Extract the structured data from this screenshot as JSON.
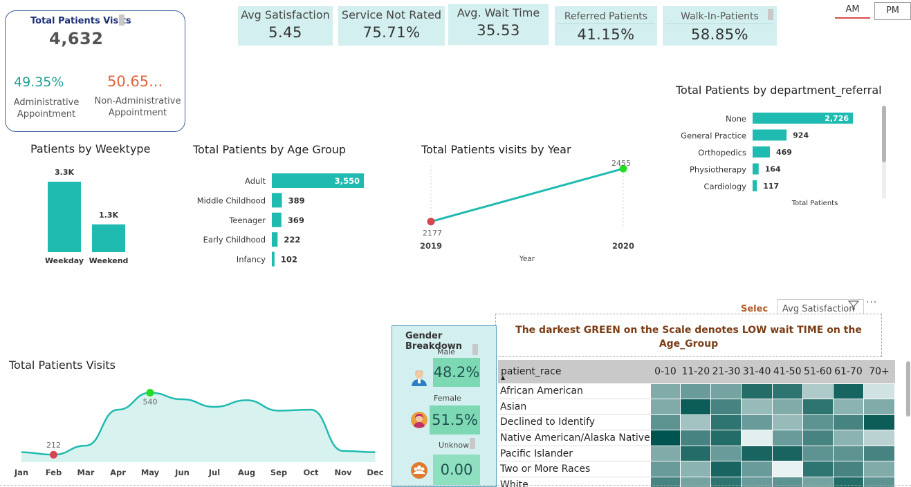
{
  "total_card": {
    "title": "Total Patients Visits",
    "value": "4,632",
    "admin_pct": "49.35%",
    "admin_label_1": "Administrative",
    "admin_label_2": "Appointment",
    "nonadmin_pct": "50.65...",
    "nonadmin_label_1": "Non-Administrative",
    "nonadmin_label_2": "Appointment"
  },
  "kpis": [
    {
      "title": "Avg Satisfaction",
      "value": "5.45"
    },
    {
      "title": "Service Not Rated",
      "value": "75.71%"
    },
    {
      "title": "Avg. Wait Time",
      "value": "35.53"
    },
    {
      "title": "Referred Patients",
      "value": "41.15%"
    },
    {
      "title": "Walk-In-Patients",
      "value": "58.85%"
    }
  ],
  "slicer": {
    "am": "AM",
    "pm": "PM",
    "selected": "AM"
  },
  "colors": {
    "teal": "#1fbab0",
    "teal_light": "#d4efef",
    "red_point": "#d64550",
    "green_point": "#22dd22",
    "note_text": "#7a3d16"
  },
  "weektype": {
    "title": "Patients by Weektype",
    "labels": [
      "3.3K",
      "1.3K"
    ],
    "chart_data": {
      "type": "bar",
      "categories": [
        "Weekday",
        "Weekend"
      ],
      "values": [
        3300,
        1300
      ]
    }
  },
  "age_group": {
    "title": "Total Patients by Age Group",
    "chart_data": {
      "type": "bar",
      "orientation": "horizontal",
      "categories": [
        "Adult",
        "Middle Childhood",
        "Teenager",
        "Early Childhood",
        "Infancy"
      ],
      "values": [
        3550,
        389,
        369,
        222,
        102
      ],
      "labels": [
        "3,550",
        "389",
        "369",
        "222",
        "102"
      ]
    }
  },
  "by_year": {
    "title": "Total Patients visits by Year",
    "xlabel": "Year",
    "chart_data": {
      "type": "line",
      "x": [
        "2019",
        "2020"
      ],
      "values": [
        2177,
        2455
      ],
      "labels": [
        "2177",
        "2455"
      ]
    }
  },
  "department": {
    "title": "Total Patients by department_referral",
    "xlabel": "Total Patients",
    "chart_data": {
      "type": "bar",
      "orientation": "horizontal",
      "categories": [
        "None",
        "General Practice",
        "Orthopedics",
        "Physiotherapy",
        "Cardiology"
      ],
      "values": [
        2726,
        924,
        469,
        164,
        117
      ],
      "labels": [
        "2,726",
        "924",
        "469",
        "164",
        "117"
      ]
    }
  },
  "monthly": {
    "title": "Total Patients Visits",
    "min_label": "212",
    "max_label": "540",
    "chart_data": {
      "type": "area",
      "x": [
        "Jan",
        "Feb",
        "Mar",
        "Apr",
        "May",
        "Jun",
        "Jul",
        "Aug",
        "Sep",
        "Oct",
        "Nov",
        "Dec"
      ],
      "values": [
        225,
        212,
        260,
        450,
        540,
        505,
        465,
        500,
        445,
        450,
        232,
        225
      ]
    }
  },
  "filter_header": {
    "selec": "Selec",
    "dropdown": "Avg Satisfaction"
  },
  "gender": {
    "title": "Gender Breakdown",
    "male_label": "Male",
    "male_value": "48.2%",
    "female_label": "Female",
    "female_value": "51.5%",
    "unknown_label": "Unknown",
    "unknown_value": "0.00"
  },
  "note": "The darkest GREEN on the Scale denotes LOW wait TIME on the Age_Group",
  "matrix": {
    "row_header": "patient_race",
    "columns": [
      "0-10",
      "11-20",
      "21-30",
      "31-40",
      "41-50",
      "51-60",
      "61-70",
      "70+"
    ],
    "rows": [
      "African American",
      "Asian",
      "Declined to Identify",
      "Native American/Alaska Native",
      "Pacific Islander",
      "Two or More Races",
      "White"
    ],
    "shades": [
      [
        0.55,
        0.45,
        0.5,
        0.15,
        0.2,
        0.75,
        0.1,
        0.9
      ],
      [
        0.55,
        0.05,
        0.3,
        0.65,
        0.55,
        0.2,
        0.6,
        0.55
      ],
      [
        0.4,
        0.7,
        0.2,
        0.45,
        0.65,
        0.4,
        0.3,
        0.05
      ],
      [
        0.0,
        0.3,
        0.15,
        0.98,
        0.45,
        0.3,
        0.6,
        0.8
      ],
      [
        0.55,
        0.15,
        0.45,
        0.1,
        0.1,
        0.4,
        0.4,
        0.3
      ],
      [
        0.45,
        0.6,
        0.1,
        0.45,
        1.0,
        0.2,
        0.3,
        0.55
      ],
      [
        0.3,
        0.5,
        0.2,
        0.45,
        0.4,
        0.5,
        0.15,
        0.4
      ]
    ]
  }
}
